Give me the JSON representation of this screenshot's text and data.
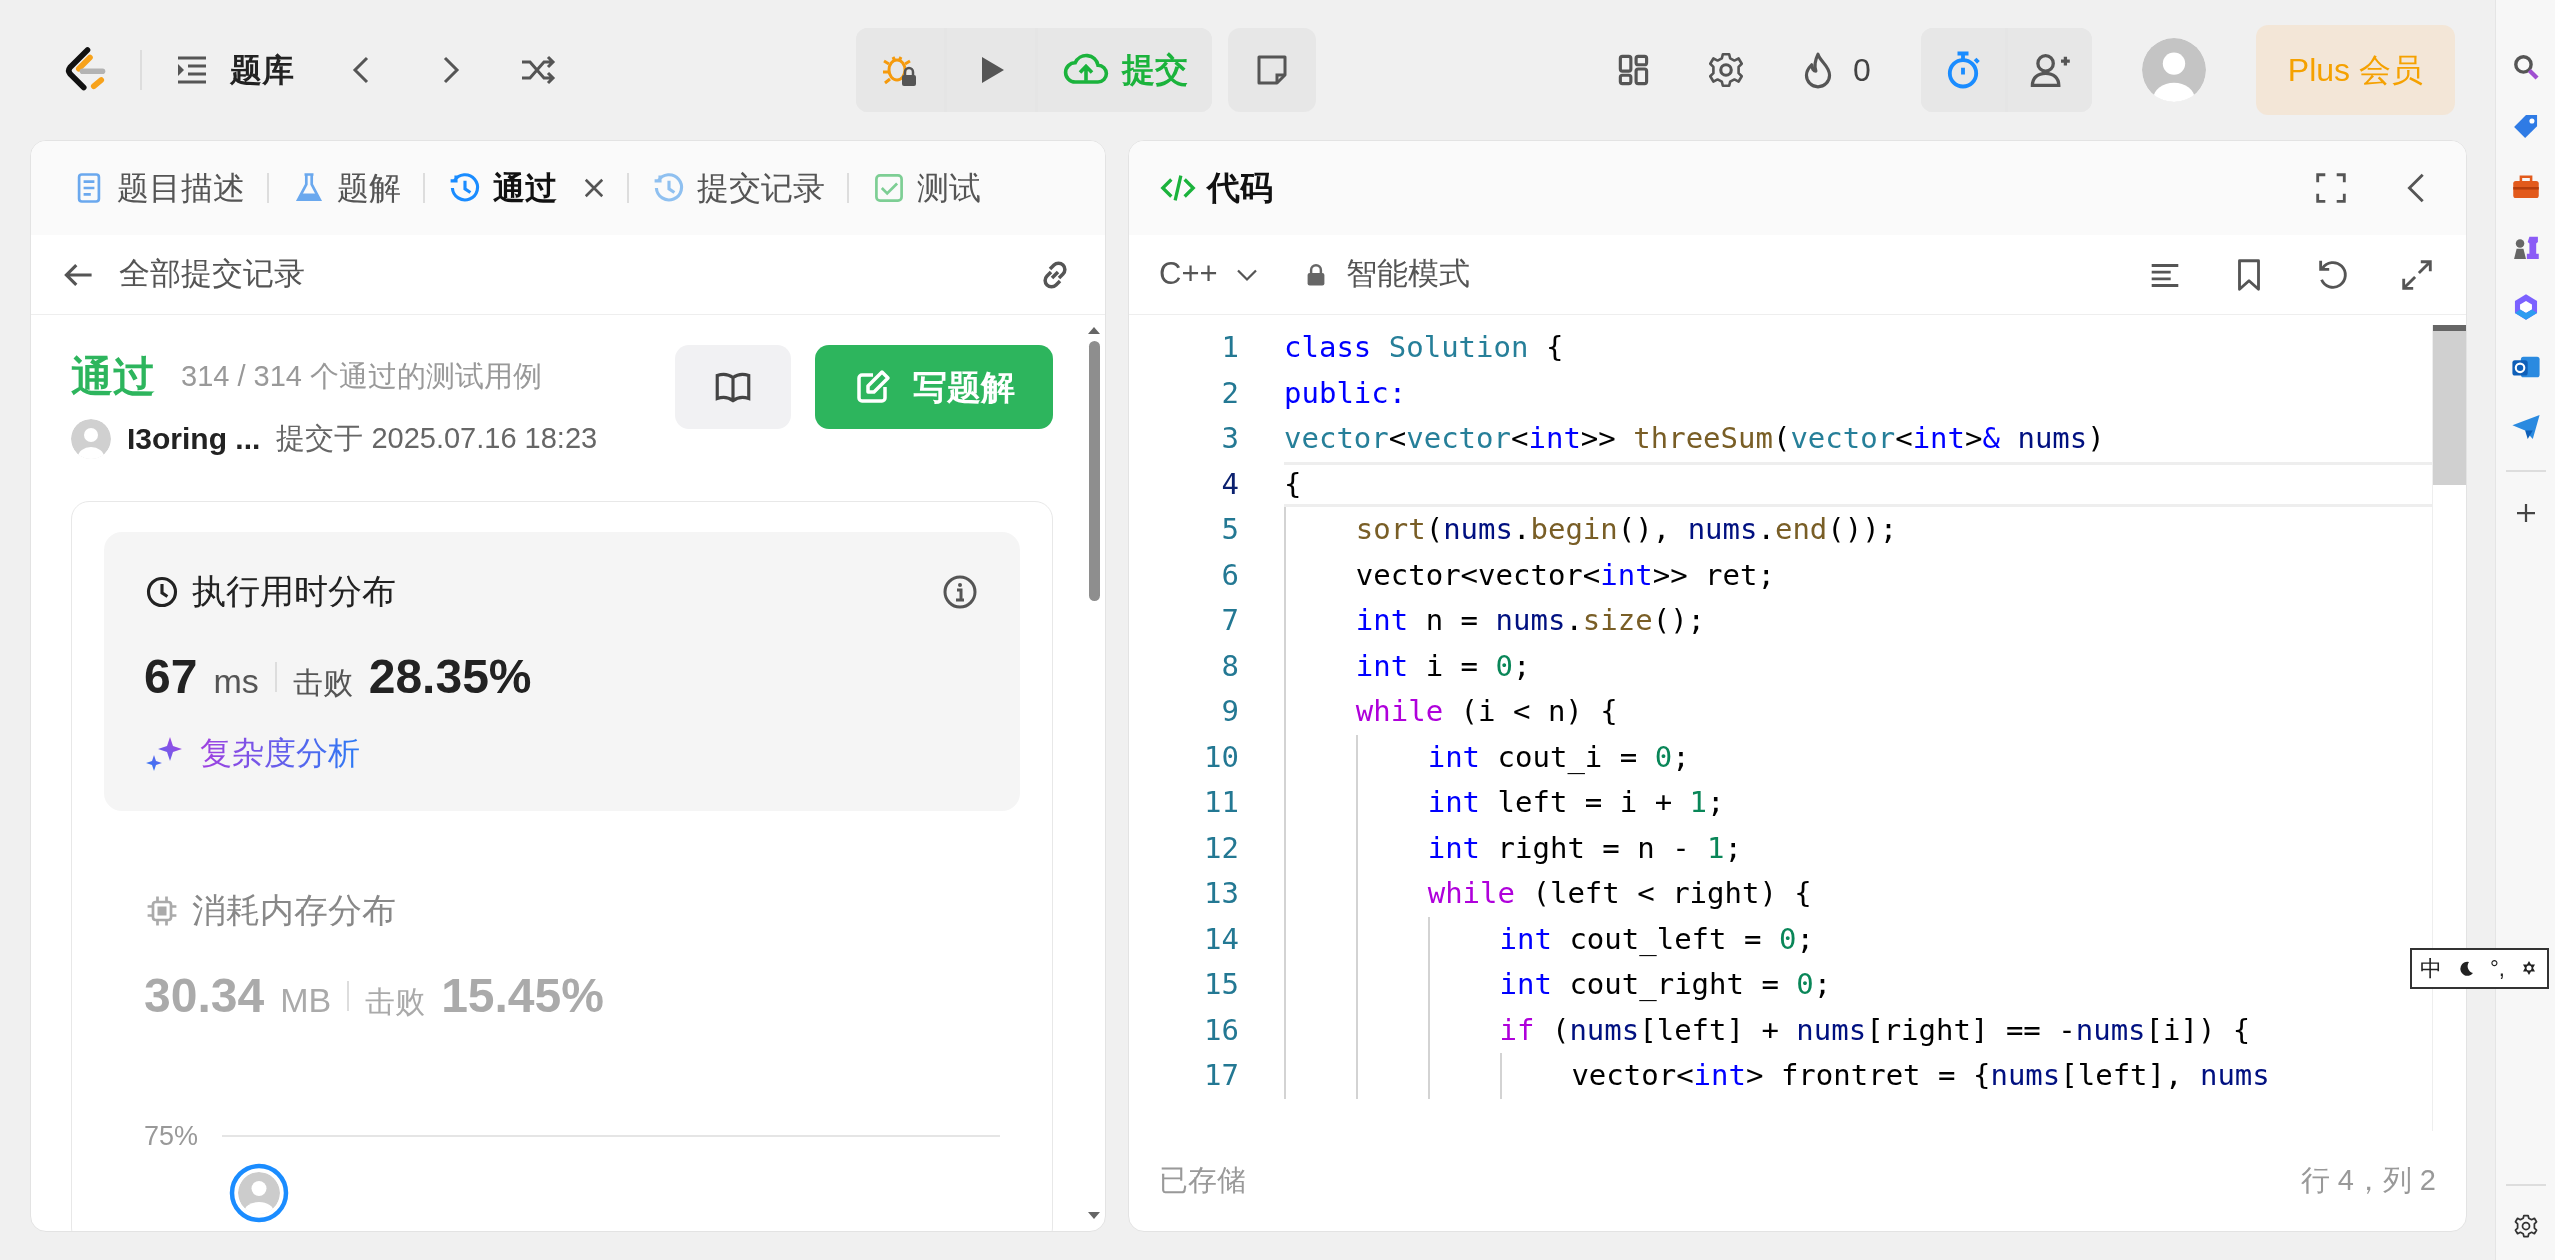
{
  "topbar": {
    "library_label": "题库",
    "submit_label": "提交",
    "fire_count": "0",
    "plus_label": "Plus 会员"
  },
  "left_panel": {
    "tabs": [
      {
        "kind": "description",
        "label": "题目描述",
        "selected": false,
        "closable": false
      },
      {
        "kind": "solutions",
        "label": "题解",
        "selected": false,
        "closable": false
      },
      {
        "kind": "result",
        "label": "通过",
        "selected": true,
        "closable": true
      },
      {
        "kind": "submissions",
        "label": "提交记录",
        "selected": false,
        "closable": false
      },
      {
        "kind": "testcase",
        "label": "测试",
        "selected": false,
        "closable": false
      }
    ],
    "back_label": "全部提交记录",
    "result": {
      "status": "通过",
      "cases": "314 / 314 个通过的测试用例",
      "user": "I3oring ...",
      "submitted": "提交于 2025.07.16 18:23",
      "write_label": "写题解"
    },
    "metrics": [
      {
        "kind": "runtime",
        "title": "执行用时分布",
        "value": "67",
        "unit": "ms",
        "beat_label": "击败",
        "beat": "28.35%",
        "selected": true,
        "analysis": "复杂度分析"
      },
      {
        "kind": "memory",
        "title": "消耗内存分布",
        "value": "30.34",
        "unit": "MB",
        "beat_label": "击败",
        "beat": "15.45%",
        "selected": false
      }
    ],
    "chart": {
      "tick_label": "75%"
    }
  },
  "code_panel": {
    "title": "代码",
    "language": "C++",
    "mode": "智能模式",
    "lines": [
      {
        "number": "1",
        "current": false,
        "tokens": [
          {
            "kind": "kw",
            "text": "class"
          },
          {
            "kind": "type",
            "text": " Solution"
          },
          {
            "kind": "plain",
            "text": " {"
          }
        ]
      },
      {
        "number": "2",
        "current": false,
        "tokens": [
          {
            "kind": "kw",
            "text": "public:"
          }
        ]
      },
      {
        "number": "3",
        "current": false,
        "tokens": [
          {
            "kind": "type",
            "text": "vector"
          },
          {
            "kind": "plain",
            "text": "<"
          },
          {
            "kind": "type",
            "text": "vector"
          },
          {
            "kind": "plain",
            "text": "<"
          },
          {
            "kind": "kw",
            "text": "int"
          },
          {
            "kind": "plain",
            "text": ">> "
          },
          {
            "kind": "fn",
            "text": "threeSum"
          },
          {
            "kind": "plain",
            "text": "("
          },
          {
            "kind": "type",
            "text": "vector"
          },
          {
            "kind": "plain",
            "text": "<"
          },
          {
            "kind": "kw",
            "text": "int"
          },
          {
            "kind": "plain",
            "text": ">"
          },
          {
            "kind": "kw",
            "text": "&"
          },
          {
            "kind": "var",
            "text": " nums"
          },
          {
            "kind": "plain",
            "text": ")"
          }
        ]
      },
      {
        "number": "4",
        "current": true,
        "tokens": [
          {
            "kind": "plain",
            "text": "{"
          }
        ]
      },
      {
        "number": "5",
        "current": false,
        "tokens": [
          {
            "kind": "fn",
            "text": "    sort"
          },
          {
            "kind": "plain",
            "text": "("
          },
          {
            "kind": "var",
            "text": "nums"
          },
          {
            "kind": "plain",
            "text": "."
          },
          {
            "kind": "fn",
            "text": "begin"
          },
          {
            "kind": "plain",
            "text": "(), "
          },
          {
            "kind": "var",
            "text": "nums"
          },
          {
            "kind": "plain",
            "text": "."
          },
          {
            "kind": "fn",
            "text": "end"
          },
          {
            "kind": "plain",
            "text": "());"
          }
        ]
      },
      {
        "number": "6",
        "current": false,
        "tokens": [
          {
            "kind": "plain",
            "text": "    vector<vector<"
          },
          {
            "kind": "kw",
            "text": "int"
          },
          {
            "kind": "plain",
            "text": ">> ret;"
          }
        ]
      },
      {
        "number": "7",
        "current": false,
        "tokens": [
          {
            "kind": "kw",
            "text": "    int"
          },
          {
            "kind": "plain",
            "text": " n = "
          },
          {
            "kind": "var",
            "text": "nums"
          },
          {
            "kind": "plain",
            "text": "."
          },
          {
            "kind": "fn",
            "text": "size"
          },
          {
            "kind": "plain",
            "text": "();"
          }
        ]
      },
      {
        "number": "8",
        "current": false,
        "tokens": [
          {
            "kind": "kw",
            "text": "    int"
          },
          {
            "kind": "plain",
            "text": " i = "
          },
          {
            "kind": "num",
            "text": "0"
          },
          {
            "kind": "plain",
            "text": ";"
          }
        ]
      },
      {
        "number": "9",
        "current": false,
        "tokens": [
          {
            "kind": "ctrl",
            "text": "    while"
          },
          {
            "kind": "plain",
            "text": " (i < n) {"
          }
        ]
      },
      {
        "number": "10",
        "current": false,
        "tokens": [
          {
            "kind": "kw",
            "text": "        int"
          },
          {
            "kind": "plain",
            "text": " cout_i = "
          },
          {
            "kind": "num",
            "text": "0"
          },
          {
            "kind": "plain",
            "text": ";"
          }
        ]
      },
      {
        "number": "11",
        "current": false,
        "tokens": [
          {
            "kind": "kw",
            "text": "        int"
          },
          {
            "kind": "plain",
            "text": " left = i + "
          },
          {
            "kind": "num",
            "text": "1"
          },
          {
            "kind": "plain",
            "text": ";"
          }
        ]
      },
      {
        "number": "12",
        "current": false,
        "tokens": [
          {
            "kind": "kw",
            "text": "        int"
          },
          {
            "kind": "plain",
            "text": " right = n - "
          },
          {
            "kind": "num",
            "text": "1"
          },
          {
            "kind": "plain",
            "text": ";"
          }
        ]
      },
      {
        "number": "13",
        "current": false,
        "tokens": [
          {
            "kind": "ctrl",
            "text": "        while"
          },
          {
            "kind": "plain",
            "text": " (left < right) {"
          }
        ]
      },
      {
        "number": "14",
        "current": false,
        "tokens": [
          {
            "kind": "kw",
            "text": "            int"
          },
          {
            "kind": "plain",
            "text": " cout_left = "
          },
          {
            "kind": "num",
            "text": "0"
          },
          {
            "kind": "plain",
            "text": ";"
          }
        ]
      },
      {
        "number": "15",
        "current": false,
        "tokens": [
          {
            "kind": "kw",
            "text": "            int"
          },
          {
            "kind": "plain",
            "text": " cout_right = "
          },
          {
            "kind": "num",
            "text": "0"
          },
          {
            "kind": "plain",
            "text": ";"
          }
        ]
      },
      {
        "number": "16",
        "current": false,
        "tokens": [
          {
            "kind": "ctrl",
            "text": "            if"
          },
          {
            "kind": "plain",
            "text": " ("
          },
          {
            "kind": "var",
            "text": "nums"
          },
          {
            "kind": "plain",
            "text": "[left] + "
          },
          {
            "kind": "var",
            "text": "nums"
          },
          {
            "kind": "plain",
            "text": "[right] == -"
          },
          {
            "kind": "var",
            "text": "nums"
          },
          {
            "kind": "plain",
            "text": "[i]) {"
          }
        ]
      },
      {
        "number": "17",
        "current": false,
        "tokens": [
          {
            "kind": "plain",
            "text": "                vector<"
          },
          {
            "kind": "kw",
            "text": "int"
          },
          {
            "kind": "plain",
            "text": "> frontret = {"
          },
          {
            "kind": "var",
            "text": "nums"
          },
          {
            "kind": "plain",
            "text": "[left], "
          },
          {
            "kind": "var",
            "text": "nums"
          }
        ]
      }
    ],
    "saved": "已存储",
    "cursor": "行 4，列 2"
  },
  "ime_bar": {
    "mode": "中",
    "punct": "°,"
  }
}
